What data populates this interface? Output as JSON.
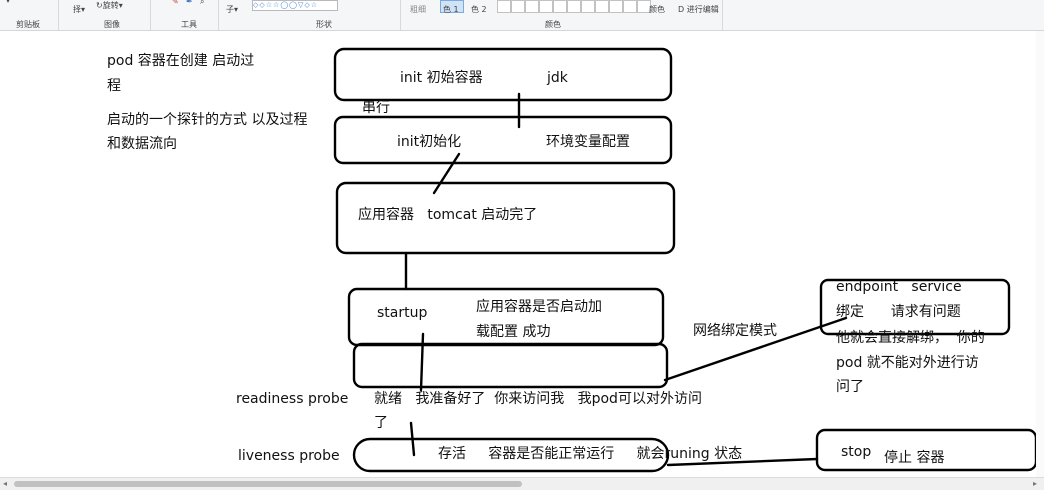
{
  "ribbon": {
    "clipboard_label": "剪贴板",
    "image_label": "图像",
    "tools_label": "工具",
    "shapes_label": "形状",
    "colors_label": "颜色",
    "rotate_label": "旋转",
    "select_label": "择",
    "outline_label": "子",
    "size_label": "粗细",
    "color1_label": "色 1",
    "color2_label": "色 2",
    "edit_colors_label": "颜色",
    "paint3d_label": "D 进行编辑"
  },
  "canvas": {
    "notes": {
      "pod_title_line1": "pod 容器在创建 启动过",
      "pod_title_line2": "程",
      "probe_desc_line1": "启动的一个探针的方式 以及过程",
      "probe_desc_line2": "和数据流向"
    },
    "boxes": {
      "init_containers": {
        "left": "init 初始容器",
        "right": "jdk"
      },
      "serial_label": "串行",
      "init_init": {
        "left": "init初始化",
        "right": "环境变量配置"
      },
      "app_container": "应用容器   tomcat 启动完了",
      "startup": {
        "label": "startup",
        "desc_line1": "应用容器是否启动加",
        "desc_line2": "载配置 成功"
      },
      "network_binding_label": "网络绑定模式",
      "endpoint": {
        "line1": "endpoint   service",
        "line2": "绑定      请求有问题",
        "line3": "他就会直接解绑，  你的",
        "line4": "pod 就不能对外进行访",
        "line5": "问了"
      },
      "readiness": {
        "label": "readiness probe",
        "text_line1": "就绪   我准备好了  你来访问我   我pod可以对外访问",
        "text_line2": "了"
      },
      "liveness": {
        "label": "liveness probe",
        "text": "存活     容器是否能正常运行     就会runing 状态"
      },
      "stop": {
        "label": "stop",
        "desc": "停止 容器"
      }
    }
  }
}
